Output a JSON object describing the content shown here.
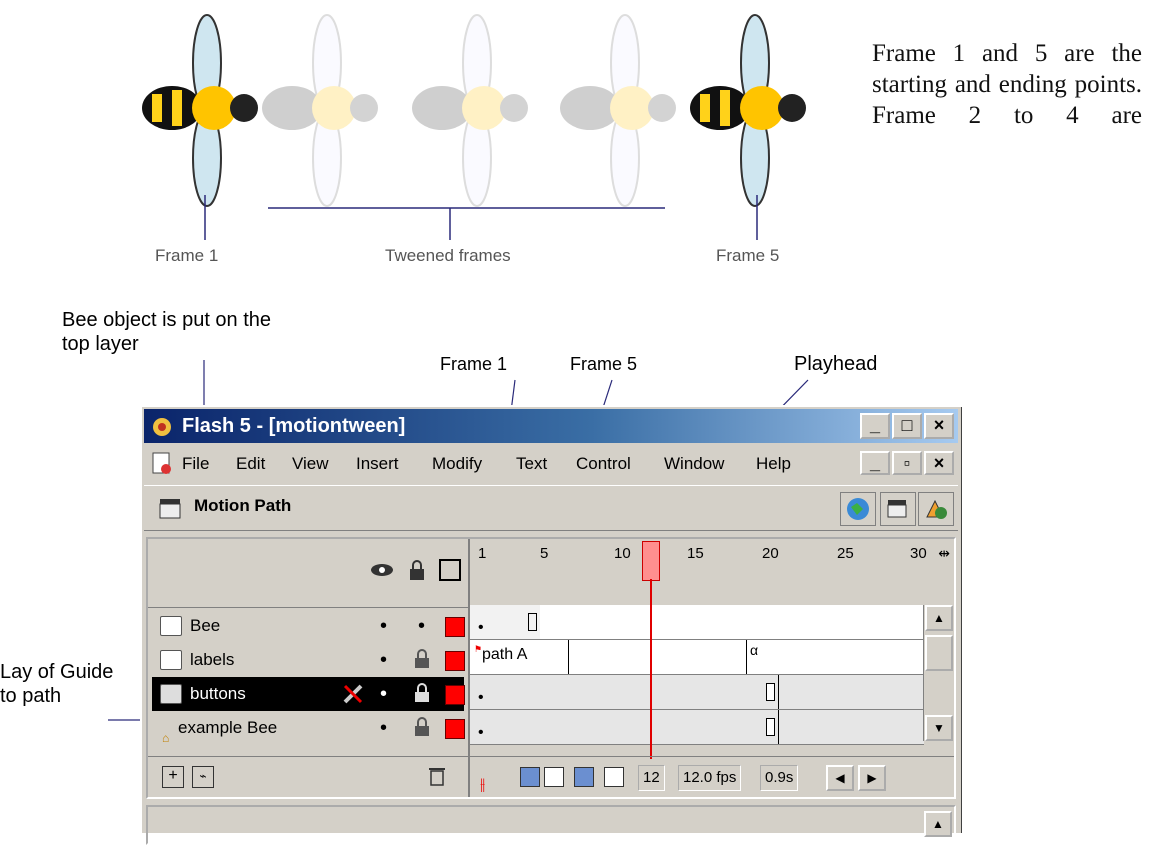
{
  "illustration": {
    "captions": {
      "frame1": "Frame 1",
      "tweened": "Tweened frames",
      "frame5": "Frame 5"
    },
    "description": "Frame 1 and 5 are the starting and ending points. Frame 2 to 4 are"
  },
  "callouts": {
    "bee_layer": "Bee object is put on the top layer",
    "frame1": "Frame 1",
    "frame5": "Frame 5",
    "playhead": "Playhead",
    "guide": "Lay of Guide to path"
  },
  "window": {
    "title": "Flash 5 - [motiontween]",
    "title_buttons": [
      "_",
      "□",
      "×"
    ],
    "doc_buttons": [
      "_",
      "▫",
      "×"
    ],
    "menu": [
      "File",
      "Edit",
      "View",
      "Insert",
      "Modify",
      "Text",
      "Control",
      "Window",
      "Help"
    ],
    "scene_name": "Motion Path",
    "toolbar_icons": [
      "globe-icon",
      "edit-scene-icon",
      "edit-symbol-icon"
    ]
  },
  "timeline": {
    "ruler_labels": [
      "1",
      "5",
      "10",
      "15",
      "20",
      "25",
      "30"
    ],
    "current_frame_marker": 12,
    "layers": [
      {
        "name": "Bee",
        "selected": false,
        "locked": false
      },
      {
        "name": "labels",
        "selected": false,
        "locked": true
      },
      {
        "name": "buttons",
        "selected": true,
        "locked": true
      },
      {
        "name": "example Bee",
        "selected": false,
        "locked": true
      }
    ],
    "frame_labels": {
      "path_a": "path A",
      "alpha": "α"
    },
    "status": {
      "current_frame": "12",
      "fps": "12.0 fps",
      "elapsed": "0.9s"
    },
    "colors": {
      "layer_outline": "#ff0000",
      "playhead": "#e00000",
      "titlebar": "#0a246a"
    }
  }
}
